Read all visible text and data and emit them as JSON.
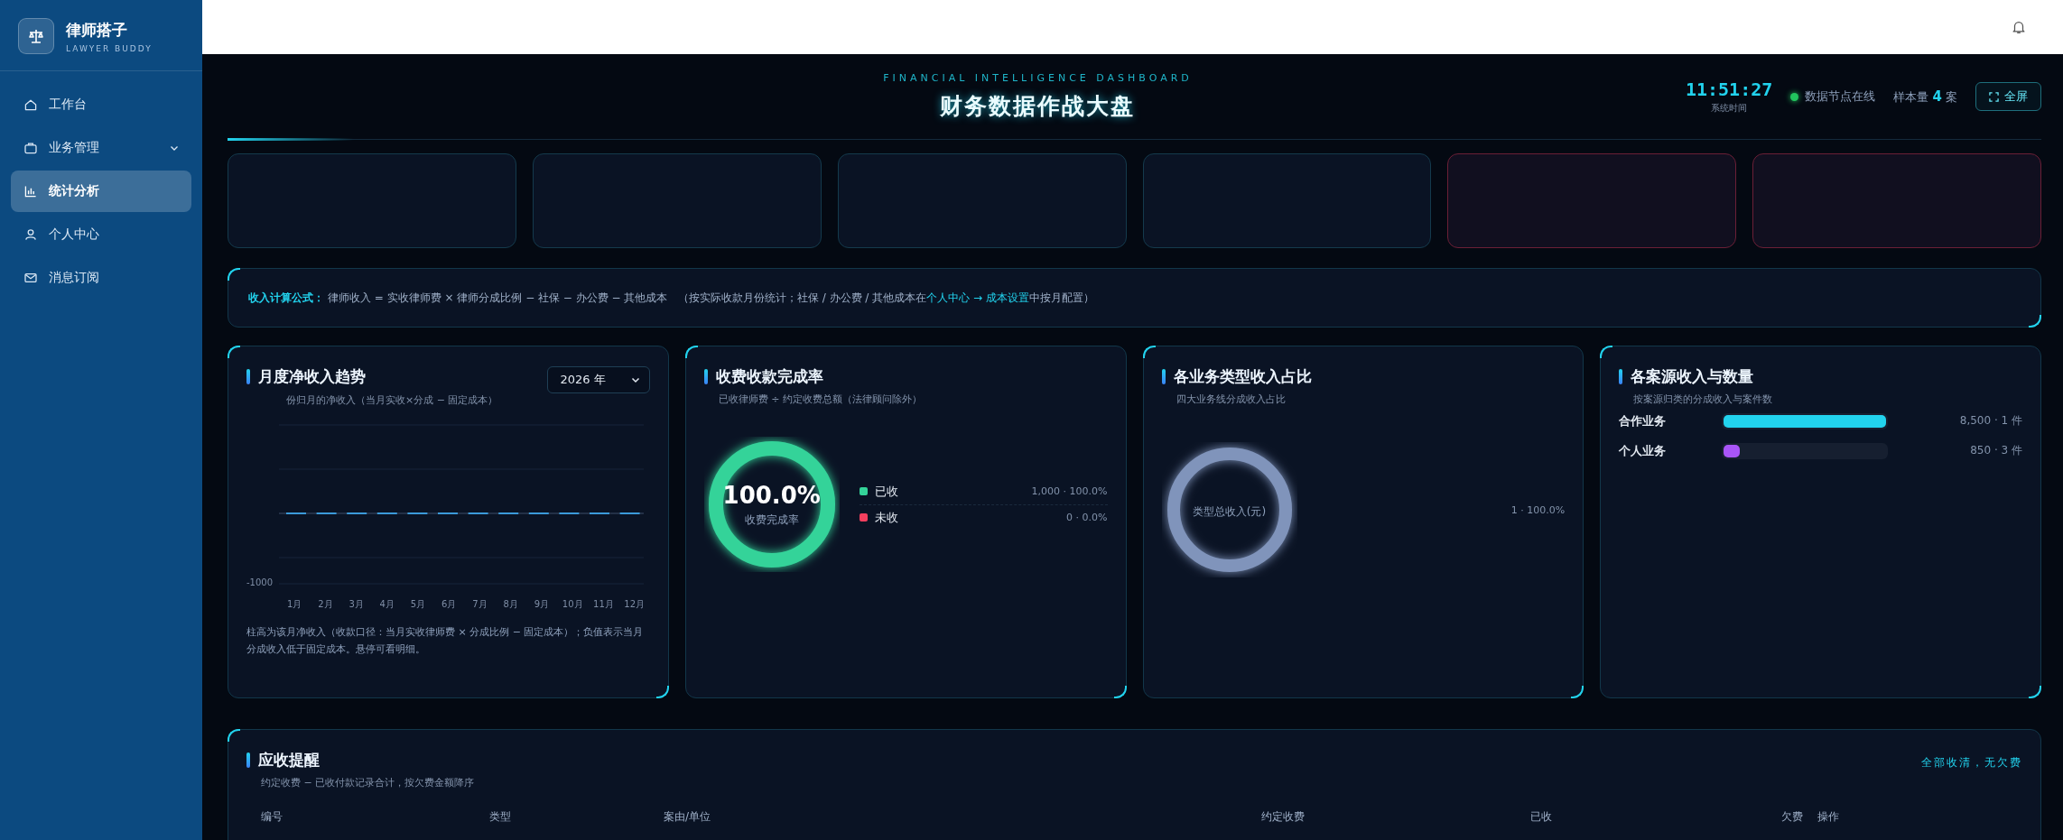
{
  "sidebar": {
    "brand": {
      "name": "律师搭子",
      "tagline": "LAWYER BUDDY"
    },
    "items": [
      {
        "label": "工作台",
        "selected": false
      },
      {
        "label": "业务管理",
        "selected": false,
        "expanded": false
      },
      {
        "label": "统计分析",
        "selected": true
      },
      {
        "label": "个人中心",
        "selected": false
      },
      {
        "label": "消息订阅",
        "selected": false
      }
    ]
  },
  "header": {
    "eyebrow": "FINANCIAL INTELLIGENCE DASHBOARD",
    "title": "财务数据作战大盘",
    "clock": "11:51:27",
    "clock_label": "系统时间",
    "status": {
      "label": "数据节点在线",
      "online": true
    },
    "sample": {
      "label": "样本量",
      "count": "4",
      "unit": "案"
    },
    "fullscreen_button": "全屏"
  },
  "stat_cards": [
    {
      "alert": false
    },
    {
      "alert": false
    },
    {
      "alert": false
    },
    {
      "alert": false
    },
    {
      "alert": true
    },
    {
      "alert": true
    }
  ],
  "formula": {
    "label": "收入计算公式：",
    "text": "律师收入 = 实收律师费 × 律师分成比例 − 社保 − 办公费 − 其他成本",
    "note_before": "（按实际收款月份统计；社保 / 办公费 / 其他成本在",
    "link": "个人中心 → 成本设置",
    "note_after": "中按月配置）"
  },
  "monthly": {
    "title": "月度净收入趋势",
    "subtitle": "份归月的净收入（当月实收×分成 − 固定成本）",
    "year_select": "2026 年",
    "y_label": "-1000",
    "months": [
      "1月",
      "2月",
      "3月",
      "4月",
      "5月",
      "6月",
      "7月",
      "8月",
      "9月",
      "10月",
      "11月",
      "12月"
    ],
    "note": "柱高为该月净收入（收款口径：当月实收律师费 × 分成比例 − 固定成本）；负值表示当月分成收入低于固定成本。悬停可看明细。"
  },
  "collection": {
    "title": "收费收款完成率",
    "subtitle": "已收律师费 ÷ 约定收费总额（法律顾问除外）",
    "level": 1,
    "percent": "100.0%",
    "center_label": "收费完成率",
    "legend": [
      {
        "label": "已收",
        "value": "1,000 · 100.0%",
        "color": "#34d399"
      },
      {
        "label": "未收",
        "value": "0 · 0.0%",
        "color": "#f43f5e"
      }
    ]
  },
  "types": {
    "title": "各业务类型收入占比",
    "subtitle": "四大业务线分成收入占比",
    "center_label": "类型总收入(元)",
    "legend": [
      {
        "value": "1 · 100.0%",
        "color": "#8094bb"
      }
    ]
  },
  "sources": {
    "title": "各案源收入与数量",
    "subtitle": "按案源归类的分成收入与案件数",
    "rows": [
      {
        "label": "合作业务",
        "level": 1,
        "value": "8,500 · 1 件",
        "color": "#22d3ee"
      },
      {
        "label": "个人业务",
        "level": 0.1,
        "value": "850 · 3 件",
        "color": "#a855f7"
      }
    ]
  },
  "receivables": {
    "title": "应收提醒",
    "subtitle": "约定收费 − 已收付款记录合计，按欠费金额降序",
    "status": "全部收清，无欠费",
    "columns": [
      "编号",
      "类型",
      "案由/单位",
      "约定收费",
      "已收",
      "欠费",
      "操作"
    ]
  }
}
